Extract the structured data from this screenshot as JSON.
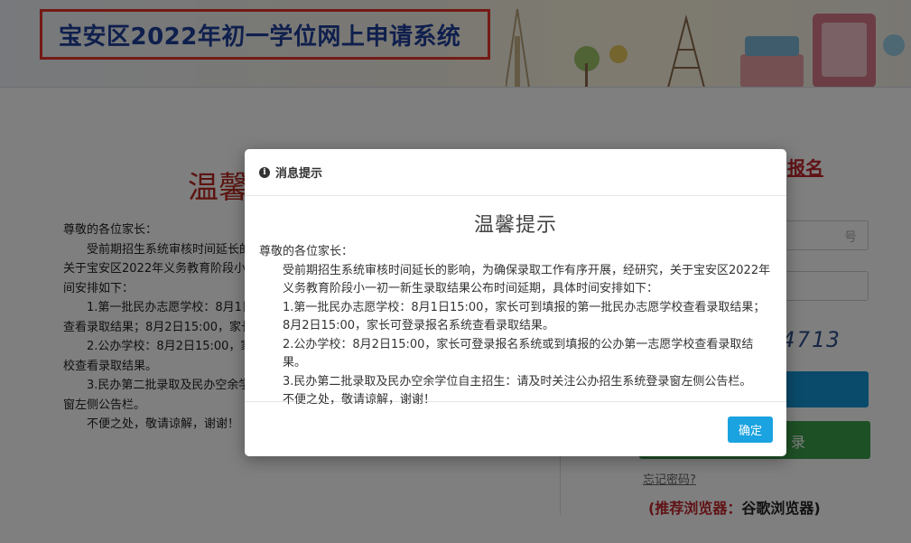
{
  "header": {
    "title": "宝安区2022年初一学位网上申请系统"
  },
  "background": {
    "notice_title": "温馨",
    "notice_lines": [
      "尊敬的各位家长：",
      "　　受前期招生系统审核时间延长的",
      "关于宝安区2022年义务教育阶段小一",
      "间安排如下：",
      "　　1.第一批民办志愿学校：8月1日",
      "查看录取结果；8月2日15:00，家长",
      "　　2.公办学校：8月2日15:00，家长",
      "校查看录取结果。",
      "　　3.民办第二批录取及民办空余学",
      "窗左侧公告栏。",
      "　　不便之处，敬请谅解，谢谢！"
    ],
    "register_link": "报名",
    "username_placeholder": "号",
    "captcha_text": "4713",
    "login_button": "录",
    "forgot_password": "忘记密码?",
    "browser_label": "(推荐浏览器：",
    "browser_name": "谷歌浏览器)"
  },
  "modal": {
    "title": "消息提示",
    "notice_title": "温馨提示",
    "greeting": "尊敬的各位家长：",
    "paragraphs": [
      "受前期招生系统审核时间延长的影响，为确保录取工作有序开展，经研究，关于宝安区2022年义务教育阶段小一初一新生录取结果公布时间延期，具体时间安排如下：",
      "1.第一批民办志愿学校：8月1日15:00，家长可到填报的第一批民办志愿学校查看录取结果；8月2日15:00，家长可登录报名系统查看录取结果。",
      "2.公办学校：8月2日15:00，家长可登录报名系统或到填报的公办第一志愿学校查看录取结果。",
      "3.民办第二批录取及民办空余学位自主招生：请及时关注公办招生系统登录窗左侧公告栏。",
      "不便之处，敬请谅解，谢谢！"
    ],
    "ok_button": "确定"
  }
}
